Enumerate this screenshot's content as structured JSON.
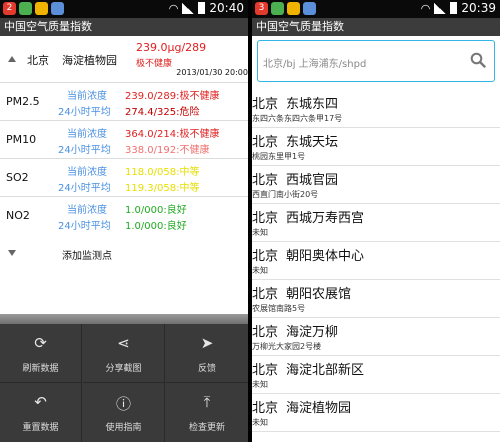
{
  "left": {
    "status": {
      "time": "20:40",
      "icon_colors": [
        "#e23b2e",
        "#4caf50",
        "#f0b400",
        "#5b8fd9"
      ],
      "badge": "2"
    },
    "app_title": "中国空气质量指数",
    "station": {
      "city": "北京",
      "name": "海淀植物园",
      "value": "239.0μg/289",
      "level": "极不健康",
      "timestamp": "2013/01/30 20:00"
    },
    "pollutants": [
      {
        "name": "PM2.5",
        "label_current": "当前浓度",
        "label_avg": "24小时平均",
        "current": "239.0/289:极不健康",
        "avg": "274.4/325:危险",
        "color_current": "#e02020",
        "color_avg": "#c00000"
      },
      {
        "name": "PM10",
        "label_current": "当前浓度",
        "label_avg": "24小时平均",
        "current": "364.0/214:极不健康",
        "avg": "338.0/192:不健康",
        "color_current": "#e02020",
        "color_avg": "#f07070"
      },
      {
        "name": "SO2",
        "label_current": "当前浓度",
        "label_avg": "24小时平均",
        "current": "118.0/058:中等",
        "avg": "119.3/058:中等",
        "color_current": "#e6e000",
        "color_avg": "#e6e000"
      },
      {
        "name": "NO2",
        "label_current": "当前浓度",
        "label_avg": "24小时平均",
        "current": "1.0/000:良好",
        "avg": "1.0/000:良好",
        "color_current": "#22aa22",
        "color_avg": "#22aa22"
      }
    ],
    "add_station": "添加监测点",
    "menu": [
      {
        "icon": "refresh-icon",
        "glyph": "⟳",
        "label": "刷新数据"
      },
      {
        "icon": "share-icon",
        "glyph": "⋖",
        "label": "分享截图"
      },
      {
        "icon": "send-icon",
        "glyph": "➤",
        "label": "反馈"
      },
      {
        "icon": "undo-icon",
        "glyph": "↶",
        "label": "重置数据"
      },
      {
        "icon": "info-icon",
        "glyph": "ⓘ",
        "label": "使用指南"
      },
      {
        "icon": "upload-icon",
        "glyph": "⤒",
        "label": "检查更新"
      }
    ]
  },
  "right": {
    "status": {
      "time": "20:39",
      "badge": "3"
    },
    "app_title": "中国空气质量指数",
    "search_placeholder": "北京/bj 上海浦东/shpd",
    "results": [
      {
        "city": "北京",
        "name": "东城东四",
        "address": "东四六条东四六条甲17号"
      },
      {
        "city": "北京",
        "name": "东城天坛",
        "address": "桃园东里甲1号"
      },
      {
        "city": "北京",
        "name": "西城官园",
        "address": "西直门南小街20号"
      },
      {
        "city": "北京",
        "name": "西城万寿西宫",
        "address": "未知"
      },
      {
        "city": "北京",
        "name": "朝阳奥体中心",
        "address": "未知"
      },
      {
        "city": "北京",
        "name": "朝阳农展馆",
        "address": "农展馆南路5号"
      },
      {
        "city": "北京",
        "name": "海淀万柳",
        "address": "万柳光大家园2号楼"
      },
      {
        "city": "北京",
        "name": "海淀北部新区",
        "address": "未知"
      },
      {
        "city": "北京",
        "name": "海淀植物园",
        "address": "未知"
      }
    ]
  }
}
